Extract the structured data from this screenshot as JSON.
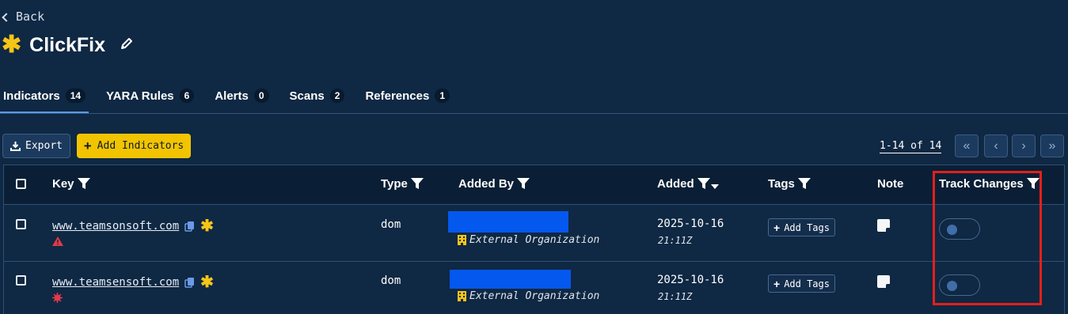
{
  "nav": {
    "back_label": "Back"
  },
  "header": {
    "title": "ClickFix",
    "star": "✱"
  },
  "tabs": [
    {
      "label": "Indicators",
      "count": "14",
      "active": true
    },
    {
      "label": "YARA Rules",
      "count": "6"
    },
    {
      "label": "Alerts",
      "count": "0"
    },
    {
      "label": "Scans",
      "count": "2"
    },
    {
      "label": "References",
      "count": "1"
    }
  ],
  "toolbar": {
    "export_label": "Export",
    "add_label": "Add Indicators",
    "pager_text": "1-14 of 14"
  },
  "table": {
    "columns": {
      "key": "Key",
      "type": "Type",
      "added_by": "Added By",
      "added": "Added",
      "tags": "Tags",
      "note": "Note",
      "track": "Track Changes"
    },
    "rows": [
      {
        "key": "www.teamsonsoft.com",
        "status_icon": "warning-triangle-icon",
        "type": "dom",
        "org": "External Organization",
        "date": "2025-10-16",
        "time": "21:11Z",
        "tags_button": "Add Tags",
        "track_enabled": false
      },
      {
        "key": "www.teamsensoft.com",
        "status_icon": "virus-icon",
        "type": "dom",
        "org": "External Organization",
        "date": "2025-10-16",
        "time": "21:11Z",
        "tags_button": "Add Tags",
        "track_enabled": false
      }
    ]
  },
  "colors": {
    "background": "#0f2843",
    "accent_yellow": "#f2c400",
    "redacted": "#0558ee",
    "highlight": "#e3201b",
    "alert_red": "#e23a4a"
  }
}
